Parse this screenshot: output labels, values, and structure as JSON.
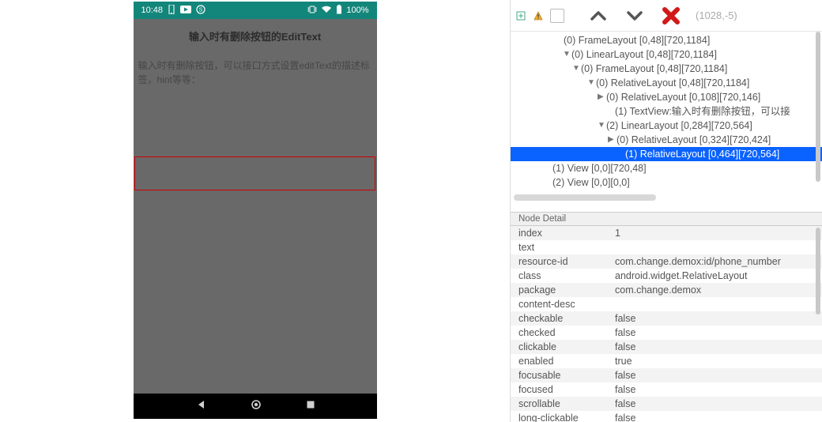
{
  "phone": {
    "status_time": "10:48",
    "status_battery": "100%",
    "appbar_title": "输入时有删除按钮的EditText",
    "desc_text": "输入时有删除按钮，可以接口方式设置editText的描述标签，hint等等："
  },
  "toolbar": {
    "coords": "(1028,-5)"
  },
  "tree": [
    {
      "indent": 56,
      "expander": "",
      "label": "(0) FrameLayout [0,48][720,1184]"
    },
    {
      "indent": 66,
      "expander": "▼",
      "label": "(0) LinearLayout [0,48][720,1184]"
    },
    {
      "indent": 78,
      "expander": "▼",
      "label": "(0) FrameLayout [0,48][720,1184]"
    },
    {
      "indent": 97,
      "expander": "▼",
      "label": "(0) RelativeLayout [0,48][720,1184]"
    },
    {
      "indent": 110,
      "expander": "▶",
      "label": "(0) RelativeLayout [0,108][720,146]"
    },
    {
      "indent": 121,
      "expander": "",
      "label": "(1) TextView:输入时有删除按钮，可以接"
    },
    {
      "indent": 110,
      "expander": "▼",
      "label": "(2) LinearLayout [0,284][720,564]"
    },
    {
      "indent": 123,
      "expander": "▶",
      "label": "(0) RelativeLayout [0,324][720,424]"
    },
    {
      "indent": 134,
      "expander": "",
      "label": "(1) RelativeLayout [0,464][720,564]",
      "selected": true
    },
    {
      "indent": 42,
      "expander": "",
      "label": "(1) View [0,0][720,48]"
    },
    {
      "indent": 42,
      "expander": "",
      "label": "(2) View [0,0][0,0]"
    }
  ],
  "detail_header": "Node Detail",
  "details": [
    {
      "k": "index",
      "v": "1"
    },
    {
      "k": "text",
      "v": ""
    },
    {
      "k": "resource-id",
      "v": "com.change.demox:id/phone_number"
    },
    {
      "k": "class",
      "v": "android.widget.RelativeLayout"
    },
    {
      "k": "package",
      "v": "com.change.demox"
    },
    {
      "k": "content-desc",
      "v": ""
    },
    {
      "k": "checkable",
      "v": "false"
    },
    {
      "k": "checked",
      "v": "false"
    },
    {
      "k": "clickable",
      "v": "false"
    },
    {
      "k": "enabled",
      "v": "true"
    },
    {
      "k": "focusable",
      "v": "false"
    },
    {
      "k": "focused",
      "v": "false"
    },
    {
      "k": "scrollable",
      "v": "false"
    },
    {
      "k": "long-clickable",
      "v": "false"
    }
  ]
}
